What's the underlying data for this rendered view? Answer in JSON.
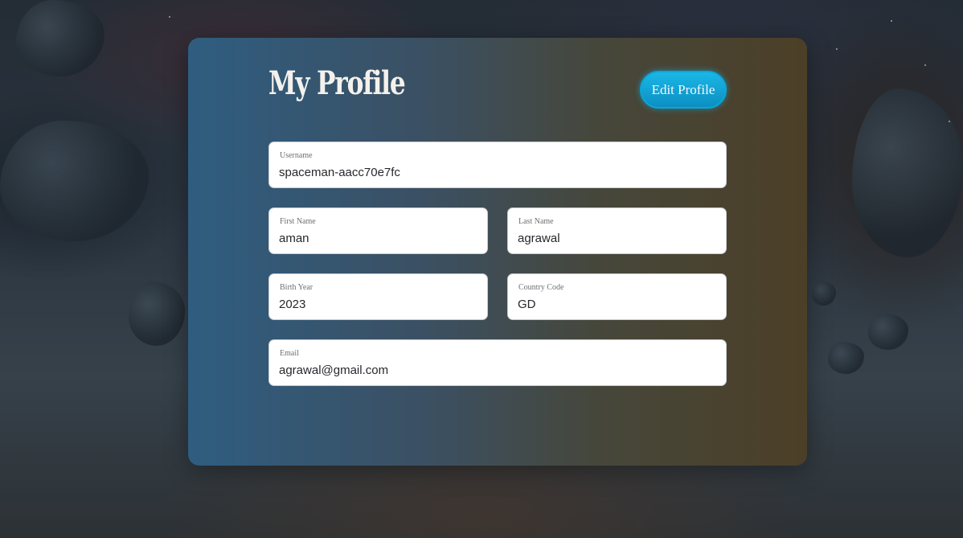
{
  "profile": {
    "title": "My Profile",
    "edit_button_label": "Edit Profile"
  },
  "fields": {
    "username": {
      "label": "Username",
      "value": "spaceman-aacc70e7fc"
    },
    "first_name": {
      "label": "First Name",
      "value": "aman"
    },
    "last_name": {
      "label": "Last Name",
      "value": "agrawal"
    },
    "birth_year": {
      "label": "Birth Year",
      "value": "2023"
    },
    "country_code": {
      "label": "Country Code",
      "value": "GD"
    },
    "email": {
      "label": "Email",
      "value": "agrawal@gmail.com"
    }
  },
  "colors": {
    "accent": "#1ab7e6",
    "card_gradient_left": "#2f5d80",
    "card_gradient_right": "#4c3f27"
  }
}
